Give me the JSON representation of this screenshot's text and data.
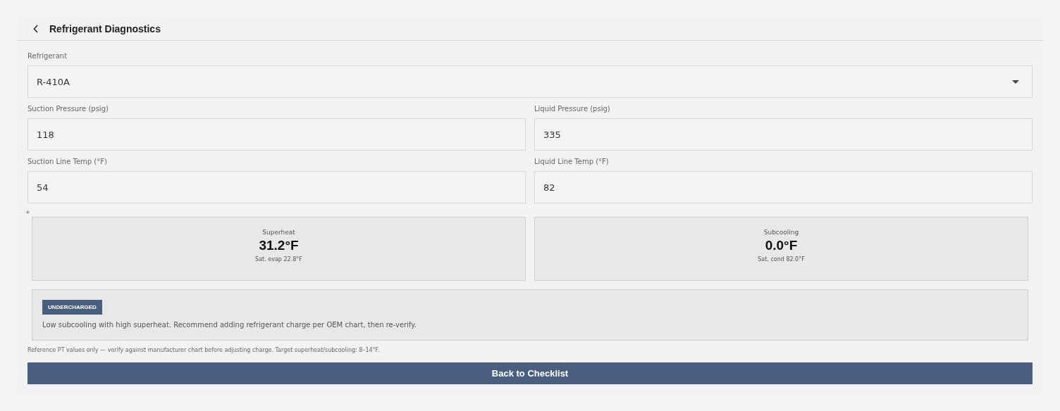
{
  "header": {
    "title": "Refrigerant Diagnostics"
  },
  "refrigerant": {
    "label": "Refrigerant",
    "value": "R-410A"
  },
  "fields": [
    {
      "label": "Suction Pressure (psig)",
      "value": "118"
    },
    {
      "label": "Liquid Pressure (psig)",
      "value": "335"
    },
    {
      "label": "Suction Line Temp (°F)",
      "value": "54"
    },
    {
      "label": "Liquid Line Temp (°F)",
      "value": "82"
    }
  ],
  "results": [
    {
      "label": "Superheat",
      "value": "31.2°F",
      "detail": "Sat. evap 22.8°F"
    },
    {
      "label": "Subcooling",
      "value": "0.0°F",
      "detail": "Sat. cond 82.0°F"
    }
  ],
  "diagnosis": {
    "badge": "UNDERCHARGED",
    "message": "Low subcooling with high superheat. Recommend adding refrigerant charge per OEM chart, then re-verify."
  },
  "note": "Reference PT values only — verify against manufacturer chart before adjusting charge. Target superheat/subcooling: 8–14°F.",
  "button": "Back to Checklist"
}
